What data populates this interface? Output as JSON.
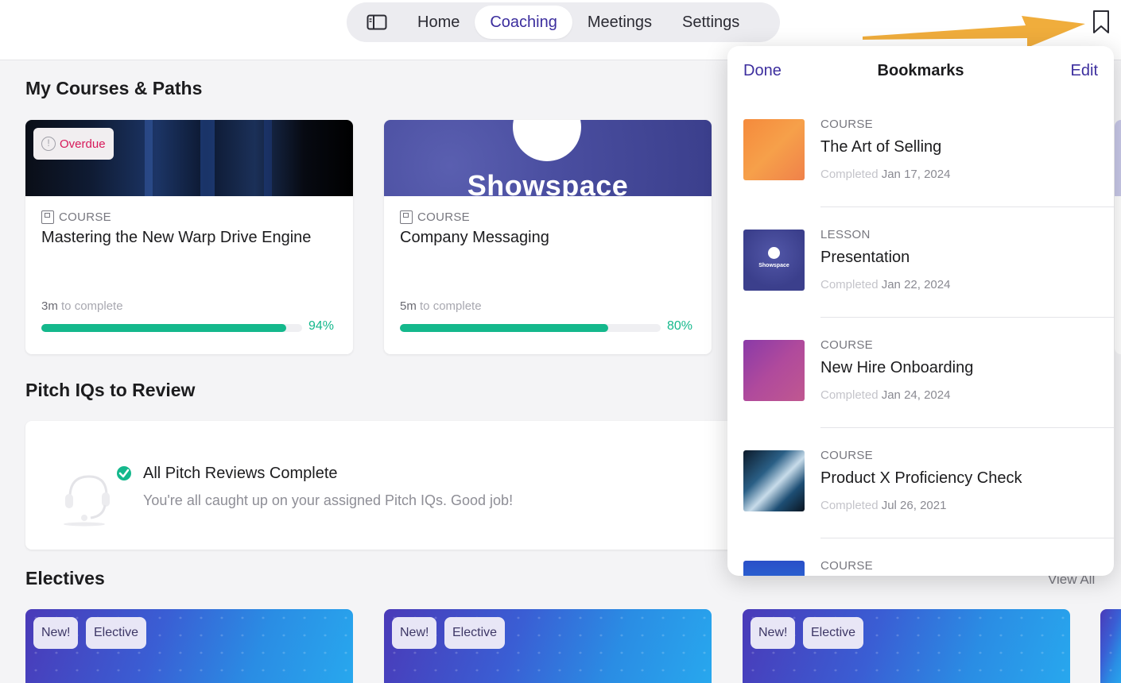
{
  "nav": {
    "tabs": [
      "Home",
      "Coaching",
      "Meetings",
      "Settings"
    ],
    "active_tab": "Coaching",
    "sidebar_icon": "sidebar-icon",
    "bookmark_icon": "bookmark-icon"
  },
  "sections": {
    "courses_title": "My Courses & Paths",
    "pitch_title": "Pitch IQs to Review",
    "electives_title": "Electives",
    "view_all": "View All"
  },
  "courses": [
    {
      "badge": "Overdue",
      "type": "COURSE",
      "title": "Mastering the New Warp Drive Engine",
      "time_value": "3m",
      "time_suffix": "to complete",
      "progress": 94,
      "progress_label": "94%"
    },
    {
      "image_text": "Showspace",
      "type": "COURSE",
      "title": "Company Messaging",
      "time_value": "5m",
      "time_suffix": "to complete",
      "progress": 80,
      "progress_label": "80%"
    }
  ],
  "pitch": {
    "title": "All Pitch Reviews Complete",
    "subtitle": "You're all caught up on your assigned Pitch IQs. Good job!"
  },
  "electives": [
    {
      "tags": [
        "New!",
        "Elective"
      ]
    },
    {
      "tags": [
        "New!",
        "Elective"
      ]
    },
    {
      "tags": [
        "New!",
        "Elective"
      ]
    }
  ],
  "bookmarks": {
    "done_label": "Done",
    "title": "Bookmarks",
    "edit_label": "Edit",
    "items": [
      {
        "type": "COURSE",
        "name": "The Art of Selling",
        "status": "Completed",
        "date": "Jan 17, 2024"
      },
      {
        "type": "LESSON",
        "name": "Presentation",
        "status": "Completed",
        "date": "Jan 22, 2024",
        "thumb_text": "Showspace"
      },
      {
        "type": "COURSE",
        "name": "New Hire Onboarding",
        "status": "Completed",
        "date": "Jan 24, 2024"
      },
      {
        "type": "COURSE",
        "name": "Product X Proficiency Check",
        "status": "Completed",
        "date": "Jul 26, 2021"
      },
      {
        "type": "COURSE",
        "name": "",
        "status": "",
        "date": ""
      }
    ]
  },
  "colors": {
    "accent": "#3c2e9e",
    "progress": "#14b88c",
    "overdue": "#d7195a",
    "arrow": "#f0ad3c"
  }
}
